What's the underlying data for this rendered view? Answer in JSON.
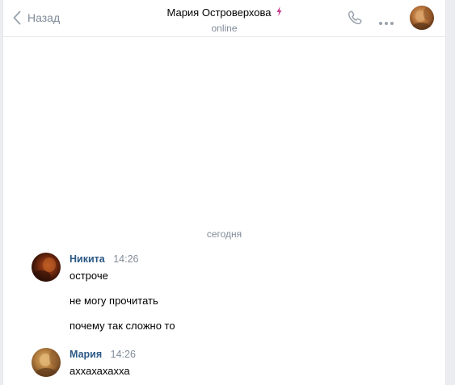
{
  "header": {
    "back_label": "Назад",
    "contact_name": "Мария Островерхова",
    "status": "online",
    "icons": {
      "back": "chevron-left-icon",
      "verified": "lightning-bolt-icon",
      "call": "phone-icon",
      "more": "more-horizontal-icon"
    }
  },
  "chat": {
    "date_separator": "сегодня",
    "groups": [
      {
        "author": "Никита",
        "time": "14:26",
        "messages": [
          "остроче",
          "не могу прочитать",
          "почему так сложно то"
        ]
      },
      {
        "author": "Мария",
        "time": "14:26",
        "messages": [
          "аххахахахха"
        ]
      }
    ]
  },
  "colors": {
    "author_link": "#2a5885",
    "muted": "#818c99",
    "bolt": "#c93c8c",
    "divider": "#e7e8ec"
  }
}
